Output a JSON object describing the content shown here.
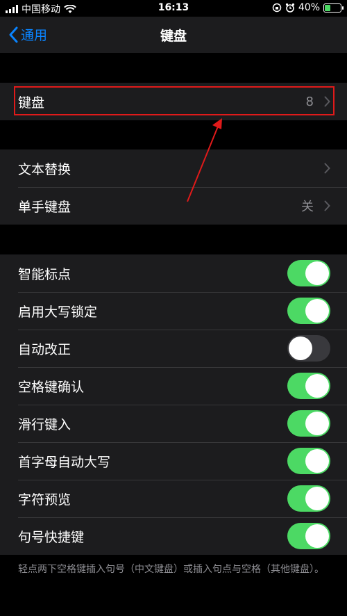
{
  "status_bar": {
    "carrier": "中国移动",
    "time": "16:13",
    "battery": "40%",
    "battery_level": 0.4
  },
  "nav": {
    "back_label": "通用",
    "title": "键盘"
  },
  "keyboards_row": {
    "label": "键盘",
    "value": "8"
  },
  "text_group": [
    {
      "label": "文本替换",
      "value": ""
    },
    {
      "label": "单手键盘",
      "value": "关"
    }
  ],
  "toggles": [
    {
      "label": "智能标点",
      "on": true
    },
    {
      "label": "启用大写锁定",
      "on": true
    },
    {
      "label": "自动改正",
      "on": false
    },
    {
      "label": "空格键确认",
      "on": true
    },
    {
      "label": "滑行键入",
      "on": true
    },
    {
      "label": "首字母自动大写",
      "on": true
    },
    {
      "label": "字符预览",
      "on": true
    },
    {
      "label": "句号快捷键",
      "on": true
    }
  ],
  "footer_note": "轻点两下空格键插入句号（中文键盘）或插入句点与空格（其他键盘）。",
  "colors": {
    "accent": "#0a84ff",
    "toggle_on": "#4cd964",
    "highlight": "#e01a1a"
  }
}
